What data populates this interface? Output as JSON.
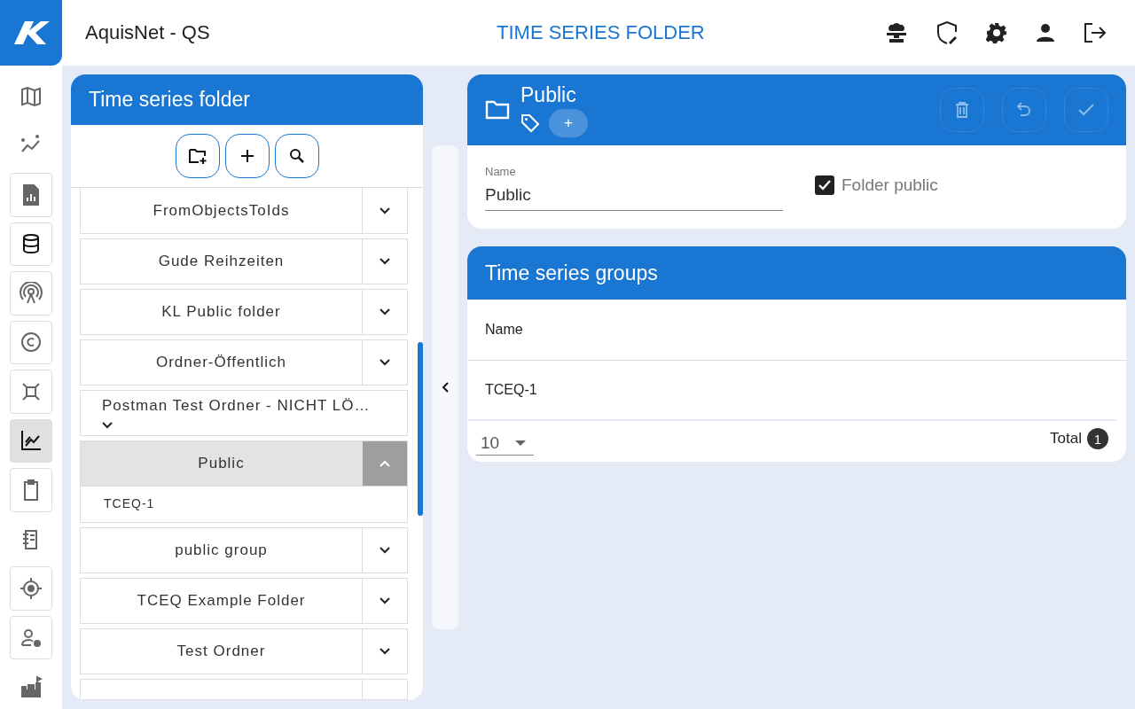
{
  "app": {
    "title": "AquisNet - QS",
    "page_title": "TIME SERIES FOLDER"
  },
  "nav": [
    {
      "kind": "map",
      "selected": false,
      "framed": false
    },
    {
      "kind": "trend",
      "selected": false,
      "framed": false
    },
    {
      "kind": "report",
      "selected": false,
      "framed": true
    },
    {
      "kind": "database",
      "selected": false,
      "framed": true
    },
    {
      "kind": "antenna",
      "selected": false,
      "framed": true
    },
    {
      "kind": "copyright",
      "selected": false,
      "framed": true
    },
    {
      "kind": "network",
      "selected": false,
      "framed": true
    },
    {
      "kind": "chart",
      "selected": true,
      "framed": true
    },
    {
      "kind": "clipboard",
      "selected": false,
      "framed": true
    },
    {
      "kind": "notes",
      "selected": false,
      "framed": false
    },
    {
      "kind": "target",
      "selected": false,
      "framed": true
    },
    {
      "kind": "usergear",
      "selected": false,
      "framed": true
    },
    {
      "kind": "castle",
      "selected": false,
      "framed": false
    }
  ],
  "folder_panel": {
    "title": "Time series folder",
    "folders": [
      {
        "label": "FromObjectsToIds",
        "expanded": false,
        "wrapped": false
      },
      {
        "label": "Gude Reihzeiten",
        "expanded": false,
        "wrapped": false
      },
      {
        "label": "KL Public folder",
        "expanded": false,
        "wrapped": false
      },
      {
        "label": "Ordner-Öffentlich",
        "expanded": false,
        "wrapped": false
      },
      {
        "label": "Postman Test Ordner - NICHT LÖ…",
        "expanded": false,
        "wrapped": true
      },
      {
        "label": "Public",
        "expanded": true,
        "wrapped": false,
        "children": [
          "TCEQ-1"
        ]
      },
      {
        "label": "public group",
        "expanded": false,
        "wrapped": false
      },
      {
        "label": "TCEQ Example Folder",
        "expanded": false,
        "wrapped": false
      },
      {
        "label": "Test Ordner",
        "expanded": false,
        "wrapped": false
      }
    ]
  },
  "detail": {
    "title": "Public",
    "tag_add": "+",
    "name_label": "Name",
    "name_value": "Public",
    "public_label": "Folder public",
    "public_checked": true
  },
  "groups": {
    "title": "Time series groups",
    "columns": [
      "Name"
    ],
    "rows": [
      "TCEQ-1"
    ],
    "page_size": "10",
    "total_label": "Total",
    "total": "1"
  }
}
